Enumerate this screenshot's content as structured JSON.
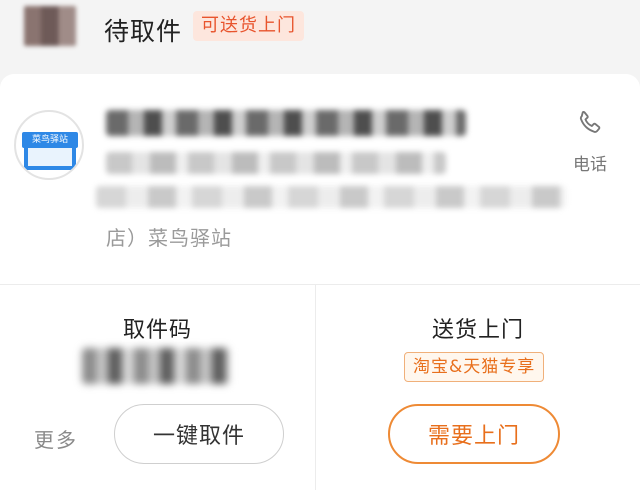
{
  "header": {
    "status_title": "待取件",
    "status_tag": "可送货上门"
  },
  "station": {
    "logo_text": "菜鸟驿站",
    "address_visible_tail": "店）菜鸟驿站",
    "phone_label": "电话"
  },
  "pickup": {
    "title": "取件码",
    "more_label": "更多",
    "one_click_label": "一键取件"
  },
  "delivery": {
    "title": "送货上门",
    "exclusive_tag": "淘宝&天猫专享",
    "door_button_label": "需要上门"
  },
  "colors": {
    "accent_orange": "#e86f1c",
    "tag_red": "#e8542d",
    "tag_red_bg": "#fde6dd",
    "logo_blue": "#2e88e6"
  },
  "icons": {
    "phone": "phone-icon",
    "station_logo": "cainiao-station-logo"
  }
}
